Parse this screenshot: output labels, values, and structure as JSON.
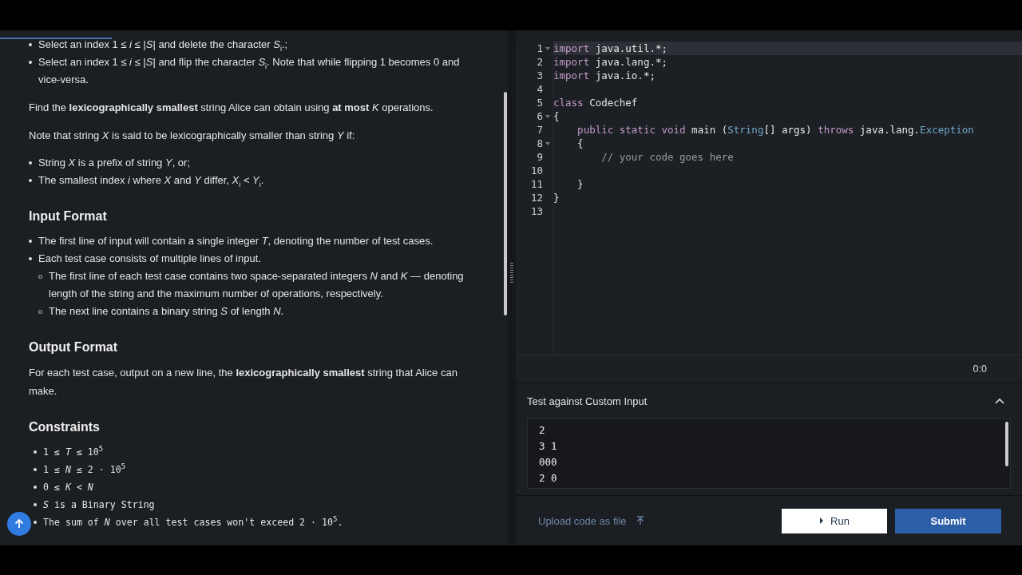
{
  "statement": [
    {
      "kind": "bullets",
      "items": [
        {
          "text": "Select an index 1 ≤ *i* ≤ |*S*| and delete the character *S*$_{i}$.;"
        },
        {
          "text": "Select an index 1 ≤ *i* ≤ |*S*| and flip the character *S*$_{i}$. Note that while flipping 1 becomes 0 and vice-versa."
        }
      ]
    },
    {
      "kind": "paragraph",
      "text": "Find the **lexicographically smallest** string Alice can obtain using **at most** *K* operations."
    },
    {
      "kind": "paragraph",
      "text": "Note that string *X* is said to be lexicographically smaller than string *Y* if:"
    },
    {
      "kind": "bullets",
      "items": [
        {
          "text": "String *X* is a prefix of string *Y*, or;"
        },
        {
          "text": "The smallest index *i* where *X* and *Y* differ, *X*$_{i}$ < *Y*$_{i}$."
        }
      ]
    },
    {
      "kind": "heading",
      "text": "Input Format"
    },
    {
      "kind": "bullets",
      "items": [
        {
          "text": "The first line of input will contain a single integer *T*, denoting the number of test cases."
        },
        {
          "text": "Each test case consists of multiple lines of input.",
          "children": [
            {
              "text": "The first line of each test case contains two space-separated integers *N* and *K* — denoting length of the string and the maximum number of operations, respectively."
            },
            {
              "text": "The next line contains a binary string *S* of length *N*."
            }
          ]
        }
      ]
    },
    {
      "kind": "heading",
      "text": "Output Format"
    },
    {
      "kind": "paragraph",
      "text": "For each test case, output on a new line, the **lexicographically smallest** string that Alice can make."
    },
    {
      "kind": "heading",
      "text": "Constraints"
    },
    {
      "kind": "constraints",
      "items": [
        {
          "text": "1 ≤ *T* ≤ 10$^{5}$"
        },
        {
          "text": "1 ≤ *N* ≤ 2 · 10$^{5}$"
        },
        {
          "text": "0 ≤ *K* < *N*"
        },
        {
          "text": "*S* is a Binary String"
        },
        {
          "text": "The sum of *N* over all test cases won't exceed 2 · 10$^{5}$."
        }
      ]
    }
  ],
  "editor": {
    "lines": [
      {
        "number": "1",
        "fold": true,
        "current": true,
        "tokens": [
          {
            "t": "import",
            "color": "#c39ac9"
          },
          {
            "t": " java.util.*;",
            "color": "#e6e6e6"
          }
        ]
      },
      {
        "number": "2",
        "fold": false,
        "current": false,
        "tokens": [
          {
            "t": "import",
            "color": "#c39ac9"
          },
          {
            "t": " java.lang.*;",
            "color": "#e6e6e6"
          }
        ]
      },
      {
        "number": "3",
        "fold": false,
        "current": false,
        "tokens": [
          {
            "t": "import",
            "color": "#c39ac9"
          },
          {
            "t": " java.io.*;",
            "color": "#e6e6e6"
          }
        ]
      },
      {
        "number": "4",
        "fold": false,
        "current": false
      },
      {
        "number": "5",
        "fold": false,
        "current": false,
        "tokens": [
          {
            "t": "class",
            "color": "#c39ac9"
          },
          {
            "t": " Codechef",
            "color": "#e6e6e6"
          }
        ]
      },
      {
        "number": "6",
        "fold": true,
        "current": false,
        "tokens": [
          {
            "t": "{",
            "color": "#e6e6e6"
          }
        ]
      },
      {
        "number": "7",
        "fold": false,
        "current": false,
        "tokens": [
          {
            "t": "    public static void",
            "color": "#c39ac9"
          },
          {
            "t": " main (",
            "color": "#e6e6e6"
          },
          {
            "t": "String",
            "color": "#6fa8c9"
          },
          {
            "t": "[] args) ",
            "color": "#e6e6e6"
          },
          {
            "t": "throws",
            "color": "#c39ac9"
          },
          {
            "t": " java.lang.",
            "color": "#e6e6e6"
          },
          {
            "t": "Exception",
            "color": "#6fa8c9"
          }
        ]
      },
      {
        "number": "8",
        "fold": true,
        "current": false,
        "tokens": [
          {
            "t": "    {",
            "color": "#e6e6e6"
          }
        ]
      },
      {
        "number": "9",
        "fold": false,
        "current": false,
        "tokens": [
          {
            "t": "        // your code goes here",
            "color": "#9a9a9a"
          }
        ]
      },
      {
        "number": "10",
        "fold": false,
        "current": false
      },
      {
        "number": "11",
        "fold": false,
        "current": false,
        "tokens": [
          {
            "t": "    }",
            "color": "#e6e6e6"
          }
        ]
      },
      {
        "number": "12",
        "fold": false,
        "current": false,
        "tokens": [
          {
            "t": "}",
            "color": "#e6e6e6"
          }
        ]
      },
      {
        "number": "13",
        "fold": false,
        "current": false
      }
    ],
    "cursor_position": "0:0"
  },
  "custom_input": {
    "title": "Test against Custom Input",
    "expanded": true,
    "value": "2\n3 1\n000\n2 0"
  },
  "footer": {
    "upload_label": "Upload code as file",
    "run_label": "Run",
    "submit_label": "Submit"
  }
}
